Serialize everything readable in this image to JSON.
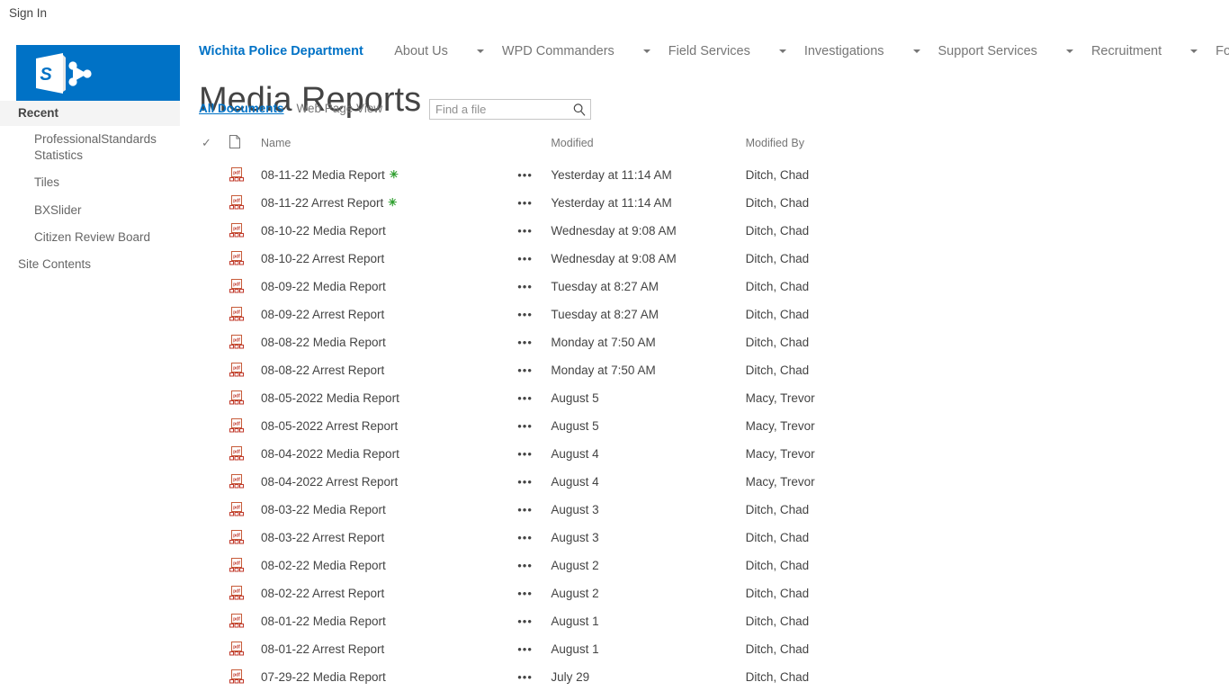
{
  "account": {
    "signin_label": "Sign In"
  },
  "logo": {
    "name": "sharepoint-logo",
    "letter": "S",
    "color": "#0072C6"
  },
  "topnav": {
    "brand": "Wichita Police Department",
    "items": [
      {
        "label": "About Us",
        "has_caret": true
      },
      {
        "label": "WPD Commanders",
        "has_caret": true
      },
      {
        "label": "Field Services",
        "has_caret": true
      },
      {
        "label": "Investigations",
        "has_caret": true
      },
      {
        "label": "Support Services",
        "has_caret": true
      },
      {
        "label": "Recruitment",
        "has_caret": true
      },
      {
        "label": "Forms",
        "has_caret": false
      }
    ]
  },
  "sidebar": {
    "recent_label": "Recent",
    "items": [
      {
        "label": "ProfessionalStandards Statistics",
        "root": false
      },
      {
        "label": "Tiles",
        "root": false
      },
      {
        "label": "BXSlider",
        "root": false
      },
      {
        "label": "Citizen Review Board",
        "root": false
      },
      {
        "label": "Site Contents",
        "root": true
      }
    ]
  },
  "page": {
    "title": "Media Reports",
    "views": [
      {
        "label": "All Documents",
        "active": true
      },
      {
        "label": "Web Page View",
        "active": false
      }
    ]
  },
  "search": {
    "placeholder": "Find a file",
    "value": ""
  },
  "doclib": {
    "columns": {
      "check": "✓",
      "icon": "",
      "name": "Name",
      "ellipsis": "",
      "modified": "Modified",
      "modified_by": "Modified By"
    },
    "new_badge_glyph": "✳",
    "ellipsis_glyph": "•••",
    "rows": [
      {
        "name": "08-11-22 Media Report",
        "is_new": true,
        "modified": "Yesterday at 11:14 AM",
        "modified_by": "Ditch, Chad"
      },
      {
        "name": "08-11-22 Arrest Report",
        "is_new": true,
        "modified": "Yesterday at 11:14 AM",
        "modified_by": "Ditch, Chad"
      },
      {
        "name": "08-10-22 Media Report",
        "is_new": false,
        "modified": "Wednesday at 9:08 AM",
        "modified_by": "Ditch, Chad"
      },
      {
        "name": "08-10-22 Arrest Report",
        "is_new": false,
        "modified": "Wednesday at 9:08 AM",
        "modified_by": "Ditch, Chad"
      },
      {
        "name": "08-09-22 Media Report",
        "is_new": false,
        "modified": "Tuesday at 8:27 AM",
        "modified_by": "Ditch, Chad"
      },
      {
        "name": "08-09-22 Arrest Report",
        "is_new": false,
        "modified": "Tuesday at 8:27 AM",
        "modified_by": "Ditch, Chad"
      },
      {
        "name": "08-08-22 Media Report",
        "is_new": false,
        "modified": "Monday at 7:50 AM",
        "modified_by": "Ditch, Chad"
      },
      {
        "name": "08-08-22 Arrest Report",
        "is_new": false,
        "modified": "Monday at 7:50 AM",
        "modified_by": "Ditch, Chad"
      },
      {
        "name": "08-05-2022 Media Report",
        "is_new": false,
        "modified": "August 5",
        "modified_by": "Macy, Trevor"
      },
      {
        "name": "08-05-2022 Arrest Report",
        "is_new": false,
        "modified": "August 5",
        "modified_by": "Macy, Trevor"
      },
      {
        "name": "08-04-2022 Media Report",
        "is_new": false,
        "modified": "August 4",
        "modified_by": "Macy, Trevor"
      },
      {
        "name": "08-04-2022 Arrest Report",
        "is_new": false,
        "modified": "August 4",
        "modified_by": "Macy, Trevor"
      },
      {
        "name": "08-03-22 Media Report",
        "is_new": false,
        "modified": "August 3",
        "modified_by": "Ditch, Chad"
      },
      {
        "name": "08-03-22 Arrest Report",
        "is_new": false,
        "modified": "August 3",
        "modified_by": "Ditch, Chad"
      },
      {
        "name": "08-02-22 Media Report",
        "is_new": false,
        "modified": "August 2",
        "modified_by": "Ditch, Chad"
      },
      {
        "name": "08-02-22 Arrest Report",
        "is_new": false,
        "modified": "August 2",
        "modified_by": "Ditch, Chad"
      },
      {
        "name": "08-01-22 Media Report",
        "is_new": false,
        "modified": "August 1",
        "modified_by": "Ditch, Chad"
      },
      {
        "name": "08-01-22 Arrest Report",
        "is_new": false,
        "modified": "August 1",
        "modified_by": "Ditch, Chad"
      },
      {
        "name": "07-29-22 Media Report",
        "is_new": false,
        "modified": "July 29",
        "modified_by": "Ditch, Chad"
      }
    ]
  }
}
